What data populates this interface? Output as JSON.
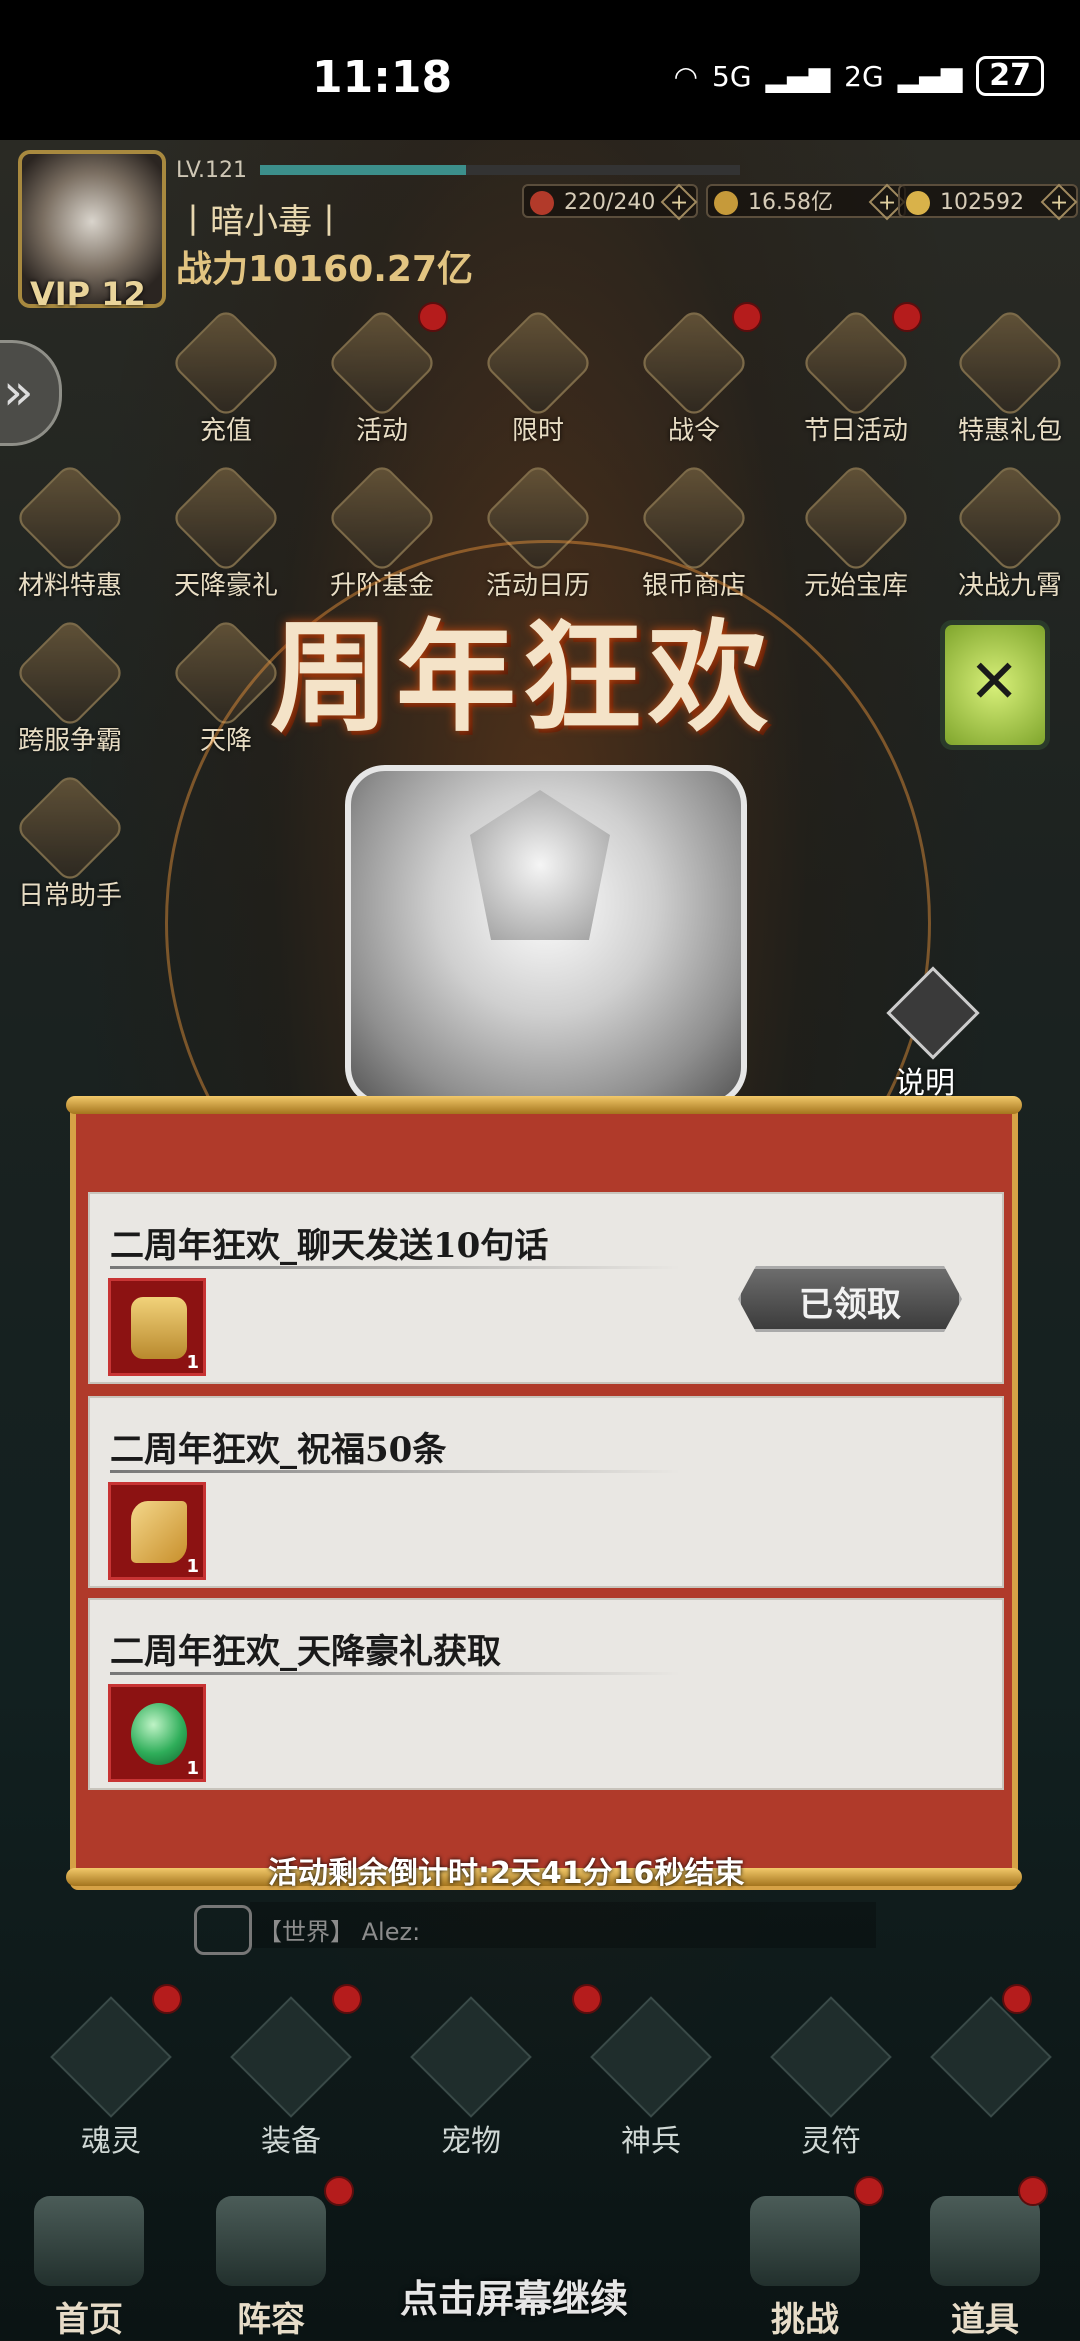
{
  "status": {
    "time": "11:18",
    "network1": "5G",
    "network2": "2G",
    "battery": "27"
  },
  "header": {
    "vip": "VIP 12",
    "level": "LV.121",
    "level_progress": 0.43,
    "name": "丨暗小毒丨",
    "power": "战力10160.27亿",
    "resources": [
      "220/240",
      "16.58亿",
      "102592"
    ]
  },
  "icons_row1": [
    "充值",
    "活动",
    "限时",
    "战令",
    "节日活动",
    "特惠礼包"
  ],
  "icons_row2": [
    "材料特惠",
    "天降豪礼",
    "升阶基金",
    "活动日历",
    "银币商店",
    "元始宝库",
    "决战九霄"
  ],
  "icons_left": [
    "跨服争霸",
    "日常助手"
  ],
  "icons_partial": "天降",
  "banner_title": "周年狂欢",
  "help_label": "说明",
  "tasks": [
    {
      "title": "二周年狂欢_聊天发送10句话",
      "count": "1",
      "reward_icon": "gold-token-icon"
    },
    {
      "title": "二周年狂欢_祝福50条",
      "count": "1",
      "reward_icon": "golden-key-icon"
    },
    {
      "title": "二周年狂欢_天降豪礼获取",
      "count": "1",
      "reward_icon": "green-orb-icon"
    }
  ],
  "claimed_label": "已领取",
  "countdown": "活动剩余倒计时:2天41分16秒结束",
  "chat": {
    "channel": "【世界】",
    "speaker": "Alez:"
  },
  "nav_row1": [
    "魂灵",
    "装备",
    "宠物",
    "神兵",
    "灵符"
  ],
  "nav_row2": [
    "首页",
    "阵容",
    "挑战",
    "道具"
  ],
  "tap_continue": "点击屏幕继续",
  "colors": {
    "panel_red": "#b03a2a",
    "gold_rail": "#d6a246",
    "card_bg": "#e9e7e3",
    "reddot": "#b51c1c"
  }
}
